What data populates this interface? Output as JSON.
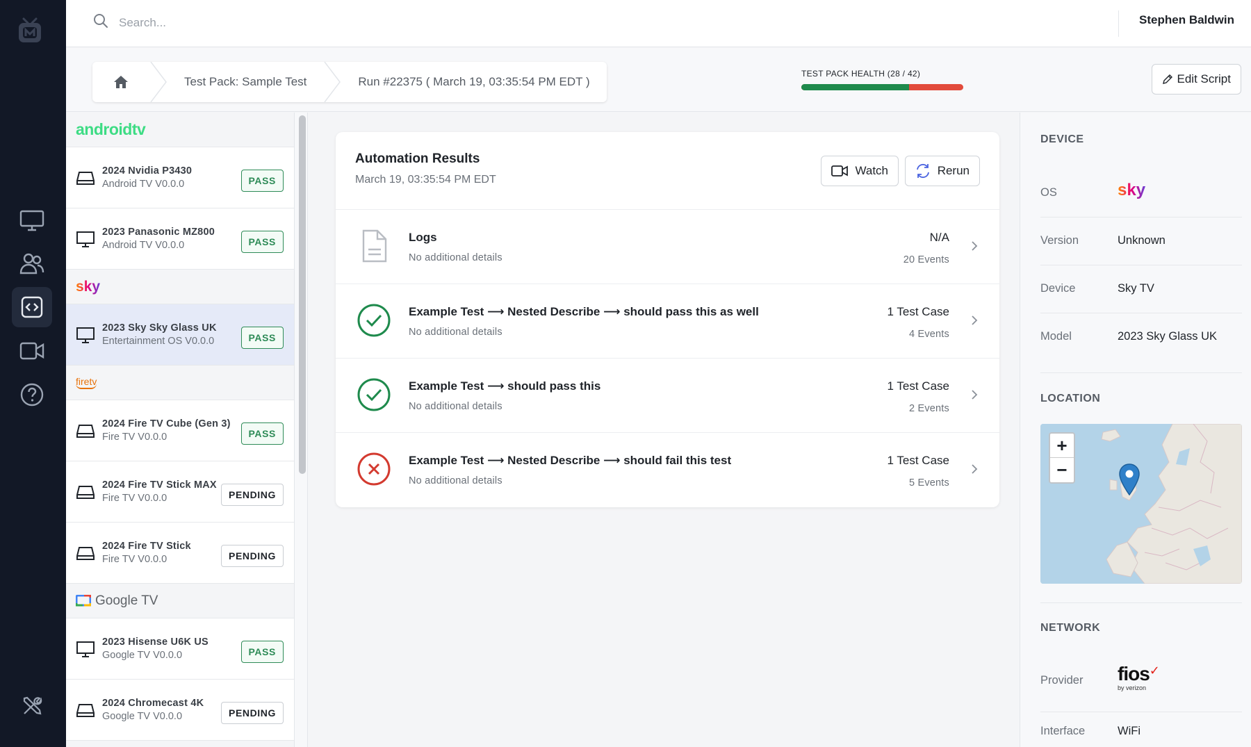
{
  "search": {
    "placeholder": "Search..."
  },
  "user": {
    "name": "Stephen Baldwin"
  },
  "breadcrumb": {
    "pack": "Test Pack: Sample Test",
    "run": "Run #22375 ( March 19, 03:35:54 PM EDT )"
  },
  "health": {
    "label": "TEST PACK HEALTH (28 / 42)",
    "passed": 28,
    "total": 42,
    "pass_color": "#1e8a4c",
    "fail_color": "#e24b3b"
  },
  "toolbar": {
    "edit_label": "Edit Script"
  },
  "brands": {
    "androidtv": "androidtv",
    "sky": "sky",
    "firetv": "firetv",
    "googletv": "Google TV"
  },
  "devices": [
    {
      "name": "2024 Nvidia P3430",
      "os": "Android TV V0.0.0",
      "status": "PASS",
      "icon": "set-top-box-icon"
    },
    {
      "name": "2023 Panasonic MZ800",
      "os": "Android TV V0.0.0",
      "status": "PASS",
      "icon": "monitor-icon"
    },
    {
      "name": "2023 Sky Sky Glass UK",
      "os": "Entertainment OS V0.0.0",
      "status": "PASS",
      "icon": "monitor-icon"
    },
    {
      "name": "2024 Fire TV Cube (Gen 3)",
      "os": "Fire TV V0.0.0",
      "status": "PASS",
      "icon": "set-top-box-icon"
    },
    {
      "name": "2024 Fire TV Stick MAX",
      "os": "Fire TV V0.0.0",
      "status": "PENDING",
      "icon": "set-top-box-icon"
    },
    {
      "name": "2024 Fire TV Stick",
      "os": "Fire TV V0.0.0",
      "status": "PENDING",
      "icon": "set-top-box-icon"
    },
    {
      "name": "2023 Hisense U6K US",
      "os": "Google TV V0.0.0",
      "status": "PASS",
      "icon": "monitor-icon"
    },
    {
      "name": "2024 Chromecast 4K",
      "os": "Google TV V0.0.0",
      "status": "PENDING",
      "icon": "set-top-box-icon"
    }
  ],
  "results": {
    "title": "Automation Results",
    "subtitle": "March 19, 03:35:54 PM EDT",
    "watch_label": "Watch",
    "rerun_label": "Rerun",
    "rows": [
      {
        "title": "Logs",
        "sub": "No additional details",
        "count": "N/A",
        "events": "20 Events",
        "status": "log"
      },
      {
        "title": "Example Test ⟶ Nested Describe ⟶ should pass this as well",
        "sub": "No additional details",
        "count": "1 Test Case",
        "events": "4 Events",
        "status": "pass"
      },
      {
        "title": "Example Test ⟶ should pass this",
        "sub": "No additional details",
        "count": "1 Test Case",
        "events": "2 Events",
        "status": "pass"
      },
      {
        "title": "Example Test ⟶ Nested Describe ⟶ should fail this test",
        "sub": "No additional details",
        "count": "1 Test Case",
        "events": "5 Events",
        "status": "fail"
      }
    ]
  },
  "device_panel": {
    "title": "DEVICE",
    "os_label": "OS",
    "os_logo": "sky",
    "version_label": "Version",
    "version": "Unknown",
    "device_label": "Device",
    "device": "Sky TV",
    "model_label": "Model",
    "model": "2023 Sky Glass UK"
  },
  "location": {
    "title": "LOCATION",
    "zoom_in": "+",
    "zoom_out": "−"
  },
  "network": {
    "title": "NETWORK",
    "provider_label": "Provider",
    "provider_logo": "fios",
    "provider_sub": "by verizon",
    "interface_label": "Interface",
    "interface": "WiFi"
  },
  "colors": {
    "pass": "#2e8b57",
    "fail": "#d33a2f",
    "rail": "#121826",
    "selected_row": "#e5eaf8"
  }
}
